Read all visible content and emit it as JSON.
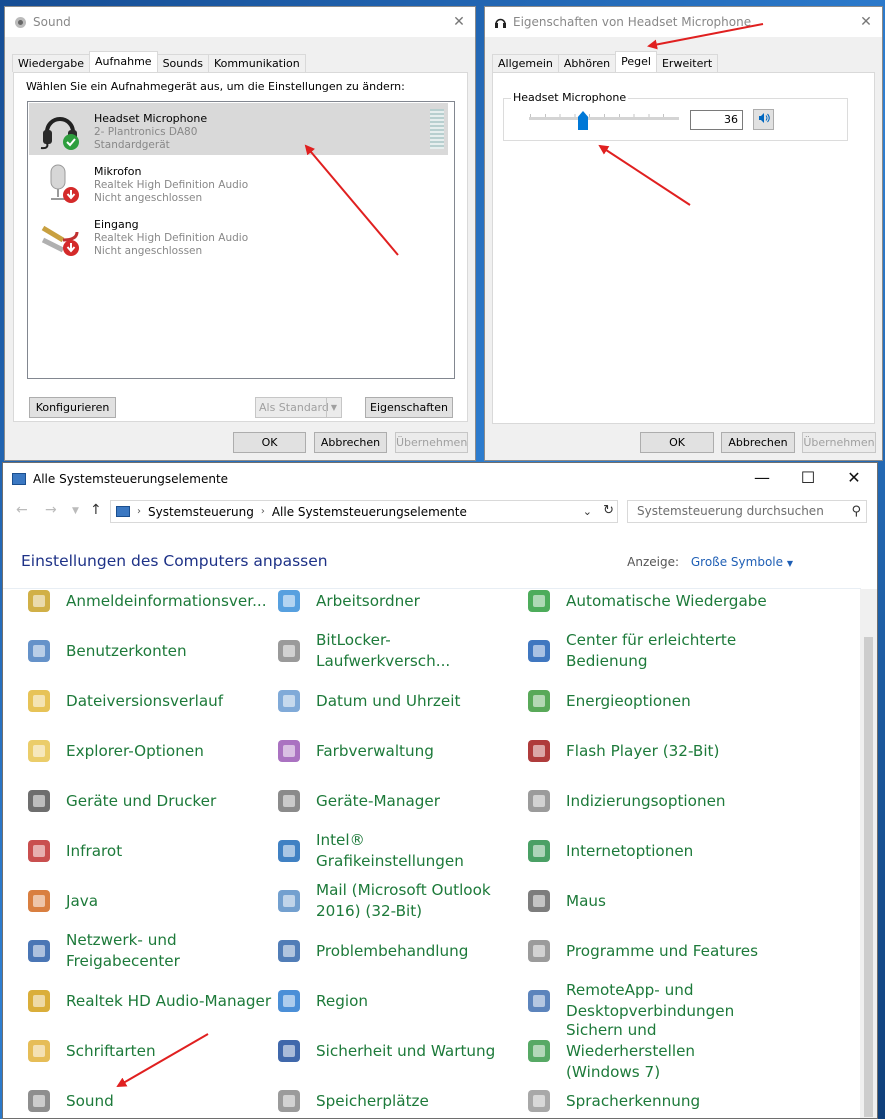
{
  "sound_dialog": {
    "title": "Sound",
    "tabs": [
      "Wiedergabe",
      "Aufnahme",
      "Sounds",
      "Kommunikation"
    ],
    "active_tab": "Aufnahme",
    "instruction": "Wählen Sie ein Aufnahmegerät aus, um die Einstellungen zu ändern:",
    "devices": [
      {
        "name": "Headset Microphone",
        "line1": "2- Plantronics DA80",
        "line2": "Standardgerät",
        "status": "default",
        "selected": true,
        "icon": "headset-icon"
      },
      {
        "name": "Mikrofon",
        "line1": "Realtek High Definition Audio",
        "line2": "Nicht angeschlossen",
        "status": "unplugged",
        "selected": false,
        "icon": "microphone-icon"
      },
      {
        "name": "Eingang",
        "line1": "Realtek High Definition Audio",
        "line2": "Nicht angeschlossen",
        "status": "unplugged",
        "selected": false,
        "icon": "line-in-icon"
      }
    ],
    "configure_label": "Konfigurieren",
    "set_default_label": "Als Standard",
    "properties_label": "Eigenschaften",
    "ok_label": "OK",
    "cancel_label": "Abbrechen",
    "apply_label": "Übernehmen"
  },
  "properties_dialog": {
    "title": "Eigenschaften von Headset Microphone",
    "tabs": [
      "Allgemein",
      "Abhören",
      "Pegel",
      "Erweitert"
    ],
    "active_tab": "Pegel",
    "group_label": "Headset Microphone",
    "level_value": "36",
    "level_fraction": 0.36,
    "ok_label": "OK",
    "cancel_label": "Abbrechen",
    "apply_label": "Übernehmen"
  },
  "control_panel": {
    "title": "Alle Systemsteuerungselemente",
    "breadcrumb": [
      "Systemsteuerung",
      "Alle Systemsteuerungselemente"
    ],
    "search_placeholder": "Systemsteuerung durchsuchen",
    "heading": "Einstellungen des Computers anpassen",
    "view_label": "Anzeige:",
    "view_value": "Große Symbole",
    "items": [
      [
        "Anmeldeinformationsver...",
        "Arbeitsordner",
        "Automatische Wiedergabe"
      ],
      [
        "Benutzerkonten",
        "BitLocker-Laufwerkversch...",
        "Center für erleichterte Bedienung"
      ],
      [
        "Dateiversionsverlauf",
        "Datum und Uhrzeit",
        "Energieoptionen"
      ],
      [
        "Explorer-Optionen",
        "Farbverwaltung",
        "Flash Player (32-Bit)"
      ],
      [
        "Geräte und Drucker",
        "Geräte-Manager",
        "Indizierungsoptionen"
      ],
      [
        "Infrarot",
        "Intel® Grafikeinstellungen",
        "Internetoptionen"
      ],
      [
        "Java",
        "Mail (Microsoft Outlook 2016) (32-Bit)",
        "Maus"
      ],
      [
        "Netzwerk- und Freigabecenter",
        "Problembehandlung",
        "Programme und Features"
      ],
      [
        "Realtek HD Audio-Manager",
        "Region",
        "RemoteApp- und Desktopverbindungen"
      ],
      [
        "Schriftarten",
        "Sicherheit und Wartung",
        "Sichern und Wiederherstellen (Windows 7)"
      ],
      [
        "Sound",
        "Speicherplätze",
        "Spracherkennung"
      ]
    ]
  },
  "colors": {
    "accent": "#0078d7",
    "link_green": "#1d7a3a",
    "heading_blue": "#1e3287",
    "annotation_red": "#e02020"
  }
}
